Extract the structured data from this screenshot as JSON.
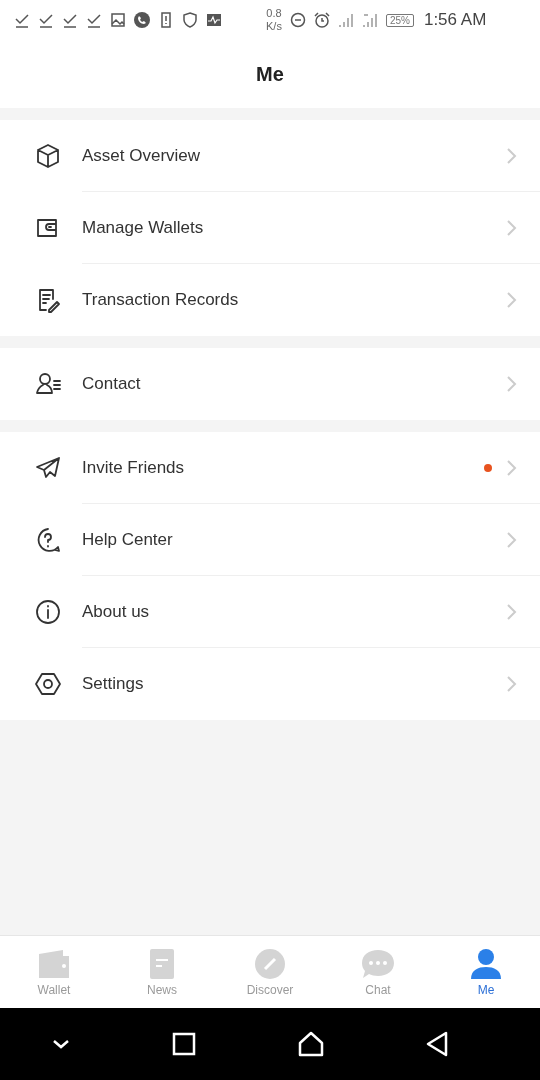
{
  "status_bar": {
    "speed_value": "0.8",
    "speed_unit": "K/s",
    "battery": "25%",
    "time": "1:56 AM"
  },
  "header": {
    "title": "Me"
  },
  "sections": [
    {
      "items": [
        {
          "kind": "cube",
          "label": "Asset Overview",
          "badge": false
        },
        {
          "kind": "wallet",
          "label": "Manage Wallets",
          "badge": false
        },
        {
          "kind": "records",
          "label": "Transaction Records",
          "badge": false
        }
      ]
    },
    {
      "items": [
        {
          "kind": "contact",
          "label": "Contact",
          "badge": false
        }
      ]
    },
    {
      "items": [
        {
          "kind": "plane",
          "label": "Invite Friends",
          "badge": true
        },
        {
          "kind": "help",
          "label": "Help Center",
          "badge": false
        },
        {
          "kind": "info",
          "label": "About us",
          "badge": false
        },
        {
          "kind": "settings",
          "label": "Settings",
          "badge": false
        }
      ]
    }
  ],
  "tabs": [
    {
      "kind": "wallet",
      "label": "Wallet",
      "selected": false
    },
    {
      "kind": "news",
      "label": "News",
      "selected": false
    },
    {
      "kind": "discover",
      "label": "Discover",
      "selected": false
    },
    {
      "kind": "chat",
      "label": "Chat",
      "selected": false
    },
    {
      "kind": "me",
      "label": "Me",
      "selected": true
    }
  ]
}
